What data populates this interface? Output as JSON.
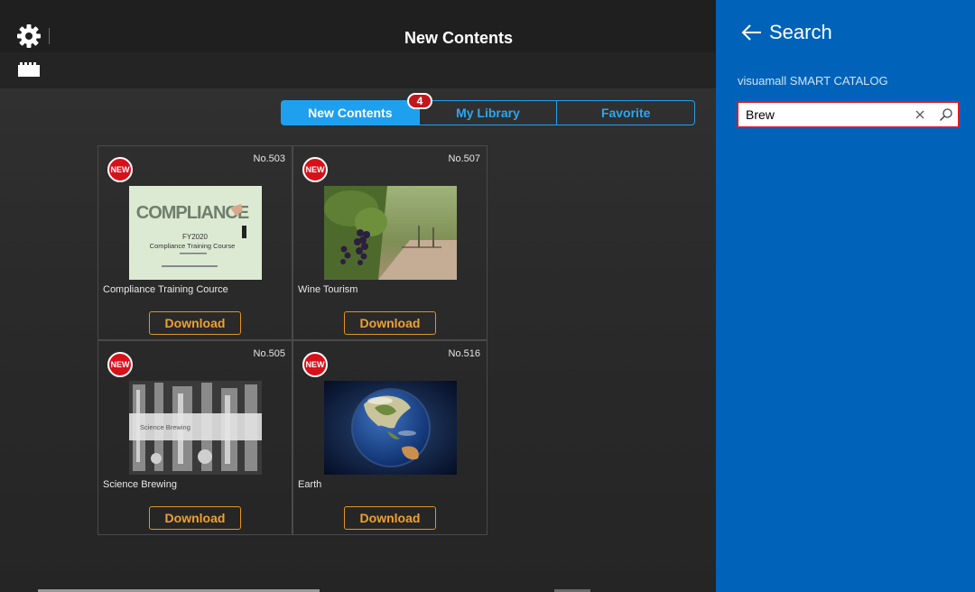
{
  "header": {
    "title": "New Contents"
  },
  "tabs": [
    {
      "label": "New Contents",
      "active": true
    },
    {
      "label": "My Library",
      "active": false
    },
    {
      "label": "Favorite",
      "active": false
    }
  ],
  "new_count_badge": "4",
  "items": [
    {
      "number": "No.503",
      "tag": "NEW",
      "name": "Compliance Training Cource",
      "download_label": "Download",
      "thumb_text": {
        "title": "COMPLIANCE",
        "year": "FY2020",
        "course": "Compliance Training Course"
      }
    },
    {
      "number": "No.507",
      "tag": "NEW",
      "name": "Wine Tourism",
      "download_label": "Download"
    },
    {
      "number": "No.505",
      "tag": "NEW",
      "name": "Science Brewing",
      "download_label": "Download",
      "thumb_text": {
        "banner": "Science Brewing"
      }
    },
    {
      "number": "No.516",
      "tag": "NEW",
      "name": "Earth",
      "download_label": "Download"
    }
  ],
  "search_panel": {
    "title": "Search",
    "app_name": "visuamall SMART CATALOG",
    "query": "Brew"
  },
  "colors": {
    "accent_blue": "#1fa0ee",
    "panel_blue": "#0063b9",
    "download_orange": "#f0a22c",
    "badge_red": "#c3161c",
    "highlight_red": "#e11b22"
  }
}
